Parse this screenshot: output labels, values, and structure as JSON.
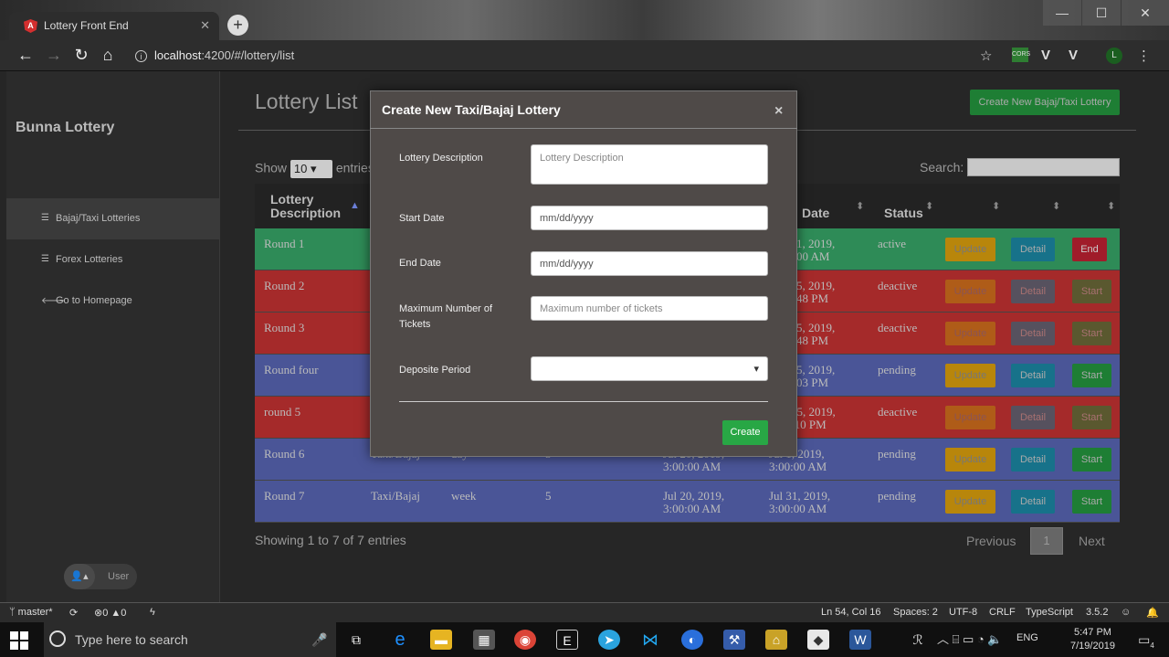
{
  "browser": {
    "tab_title": "Lottery Front End",
    "url_host": "localhost",
    "url_rest": ":4200/#/lottery/list"
  },
  "sidebar": {
    "brand": "Bunna Lottery",
    "items": [
      {
        "label": "Bajaj/Taxi Lotteries",
        "icon": "list-icon"
      },
      {
        "label": "Forex Lotteries",
        "icon": "list-icon"
      },
      {
        "label": "Go to Homepage",
        "icon": "arrow-left-icon"
      }
    ],
    "user": "User"
  },
  "header": {
    "title": "Lottery List",
    "create_button": "Create New Bajaj/Taxi Lottery"
  },
  "table_controls": {
    "show": "Show",
    "length": "10",
    "entries": "entries",
    "search": "Search:"
  },
  "table": {
    "columns": [
      "Lottery Description",
      "",
      "",
      "",
      "",
      "Date",
      "Status",
      "",
      "",
      ""
    ],
    "rows": [
      {
        "desc": "Round 1",
        "type": "",
        "period": "",
        "max": "",
        "start": "",
        "end_l1": "1, 2019,",
        "end_l2": "00 AM",
        "status": "active",
        "action": "End",
        "color": "#2e8b57"
      },
      {
        "desc": "Round 2",
        "type": "",
        "period": "",
        "max": "",
        "start": "",
        "end_l1": "5, 2019,",
        "end_l2": "48 PM",
        "status": "deactive",
        "action": "Start",
        "color": "#a52a2a"
      },
      {
        "desc": "Round 3",
        "type": "",
        "period": "",
        "max": "",
        "start": "",
        "end_l1": "5, 2019,",
        "end_l2": "48 PM",
        "status": "deactive",
        "action": "Start",
        "color": "#a52a2a"
      },
      {
        "desc": "Round four",
        "type": "",
        "period": "",
        "max": "",
        "start": "",
        "end_l1": "5, 2019,",
        "end_l2": "03 PM",
        "status": "pending",
        "action": "Start",
        "color": "#4a5597"
      },
      {
        "desc": "round 5",
        "type": "",
        "period": "",
        "max": "",
        "start": "",
        "end_l1": "15, 2019,",
        "end_l2": ":10 PM",
        "status": "deactive",
        "action": "Start",
        "color": "#a52a2a"
      },
      {
        "desc": "Round 6",
        "type": "Taxi/Bajaj",
        "period": "day",
        "max": "5",
        "start_l1": "Jul 20, 2019,",
        "start_l2": "3:00:00 AM",
        "end_l1": "Jul 1, 2019,",
        "end_l2": "3:00:00 AM",
        "status": "pending",
        "action": "Start",
        "color": "#4a5597"
      },
      {
        "desc": "Round 7",
        "type": "Taxi/Bajaj",
        "period": "week",
        "max": "5",
        "start_l1": "Jul 20, 2019,",
        "start_l2": "3:00:00 AM",
        "end_l1": "Jul 31, 2019,",
        "end_l2": "3:00:00 AM",
        "status": "pending",
        "action": "Start",
        "color": "#4a5597"
      }
    ],
    "update_label": "Update",
    "detail_label": "Detail"
  },
  "footer": {
    "info": "Showing 1 to 7 of 7 entries",
    "previous": "Previous",
    "page": "1",
    "next": "Next"
  },
  "modal": {
    "title": "Create New Taxi/Bajaj Lottery",
    "close": "×",
    "fields": {
      "description_label": "Lottery Description",
      "description_placeholder": "Lottery Description",
      "start_label": "Start Date",
      "start_value": "mm/dd/yyyy",
      "end_label": "End Date",
      "end_value": "mm/dd/yyyy",
      "max_label": "Maximum Number of Tickets",
      "max_placeholder": "Maximum number of tickets",
      "period_label": "Deposite Period"
    },
    "create": "Create"
  },
  "statusbar": {
    "branch": "master*",
    "errors": "0",
    "warnings": "0",
    "position": "Ln 54, Col 16",
    "spaces": "Spaces: 2",
    "encoding": "UTF-8",
    "eol": "CRLF",
    "language": "TypeScript",
    "version": "3.5.2"
  },
  "taskbar": {
    "search_placeholder": "Type here to search",
    "lang": "ENG",
    "time": "5:47 PM",
    "date": "7/19/2019",
    "notif": "4"
  }
}
